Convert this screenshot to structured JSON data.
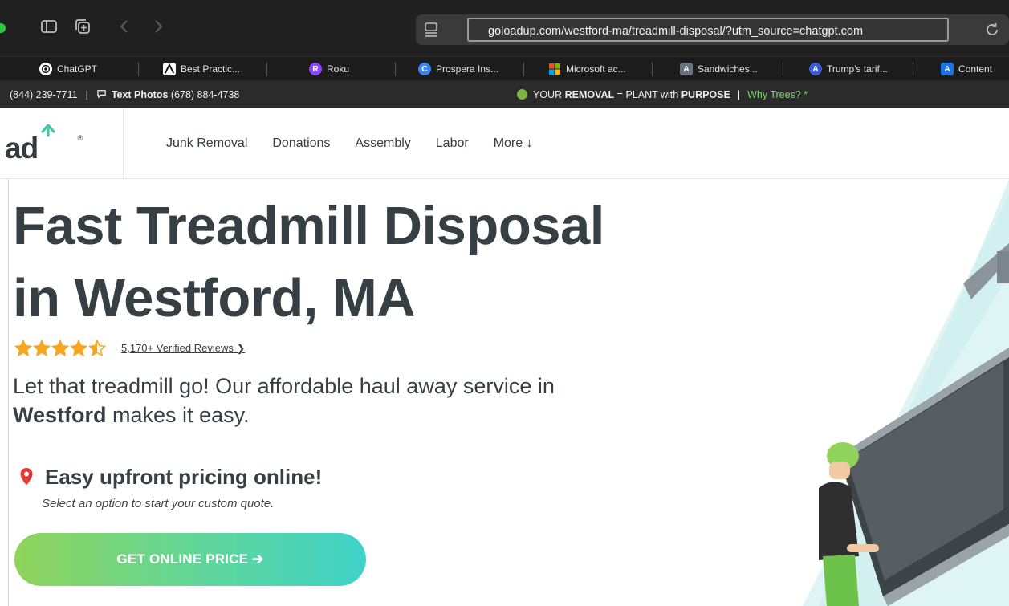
{
  "browser": {
    "url": "goloadup.com/westford-ma/treadmill-disposal/?utm_source=chatgpt.com",
    "icons": [
      "sidebar-icon",
      "tab-overview-icon",
      "back-icon",
      "forward-icon",
      "reader-icon",
      "reload-icon"
    ]
  },
  "bookmarks": [
    {
      "label": "ChatGPT",
      "icon": "chatgpt-icon",
      "color": "#ffffff"
    },
    {
      "label": "Best Practic...",
      "icon": "a-logo-icon",
      "color": "#ffffff"
    },
    {
      "label": "Roku",
      "icon": "roku-icon",
      "color": "#8e44ff"
    },
    {
      "label": "Prospera Ins...",
      "icon": "prospera-icon",
      "color": "#3b82f6"
    },
    {
      "label": "Microsoft ac...",
      "icon": "microsoft-icon",
      "color": "#f25022"
    },
    {
      "label": "Sandwiches...",
      "icon": "a-box-icon",
      "color": "#6b7280"
    },
    {
      "label": "Trump's tarif...",
      "icon": "a-circle-icon",
      "color": "#3b5bdb"
    },
    {
      "label": "Content",
      "icon": "content-icon",
      "color": "#1a73e8"
    }
  ],
  "promo": {
    "phone": "(844) 239-7711",
    "text_photos_label": "Text Photos",
    "text_photos_number": "(678) 884-4738",
    "your": "YOUR",
    "removal": "REMOVAL",
    "plant_with": "= PLANT with",
    "purpose": "PURPOSE",
    "why_trees": "Why Trees? *"
  },
  "header": {
    "logo_main": "ad",
    "logo_up": "Up",
    "nav": [
      "Junk Removal",
      "Donations",
      "Assembly",
      "Labor",
      "More ↓"
    ]
  },
  "hero": {
    "title_line1": "Fast Treadmill Disposal",
    "title_line2": "in Westford, MA",
    "rating": 4.5,
    "reviews": "5,170+ Verified Reviews ❯",
    "sub_text": "Let that treadmill go! Our affordable haul away service in",
    "sub_bold": "Westford",
    "sub_tail": "makes it easy.",
    "pricing_heading": "Easy upfront pricing online!",
    "pricing_sub": "Select an option to start your custom quote.",
    "cta": "GET ONLINE PRICE ➔"
  },
  "colors": {
    "brand_teal": "#41c6a8",
    "star": "#f5a623",
    "pin": "#e53935",
    "text_dark": "#363f43"
  }
}
